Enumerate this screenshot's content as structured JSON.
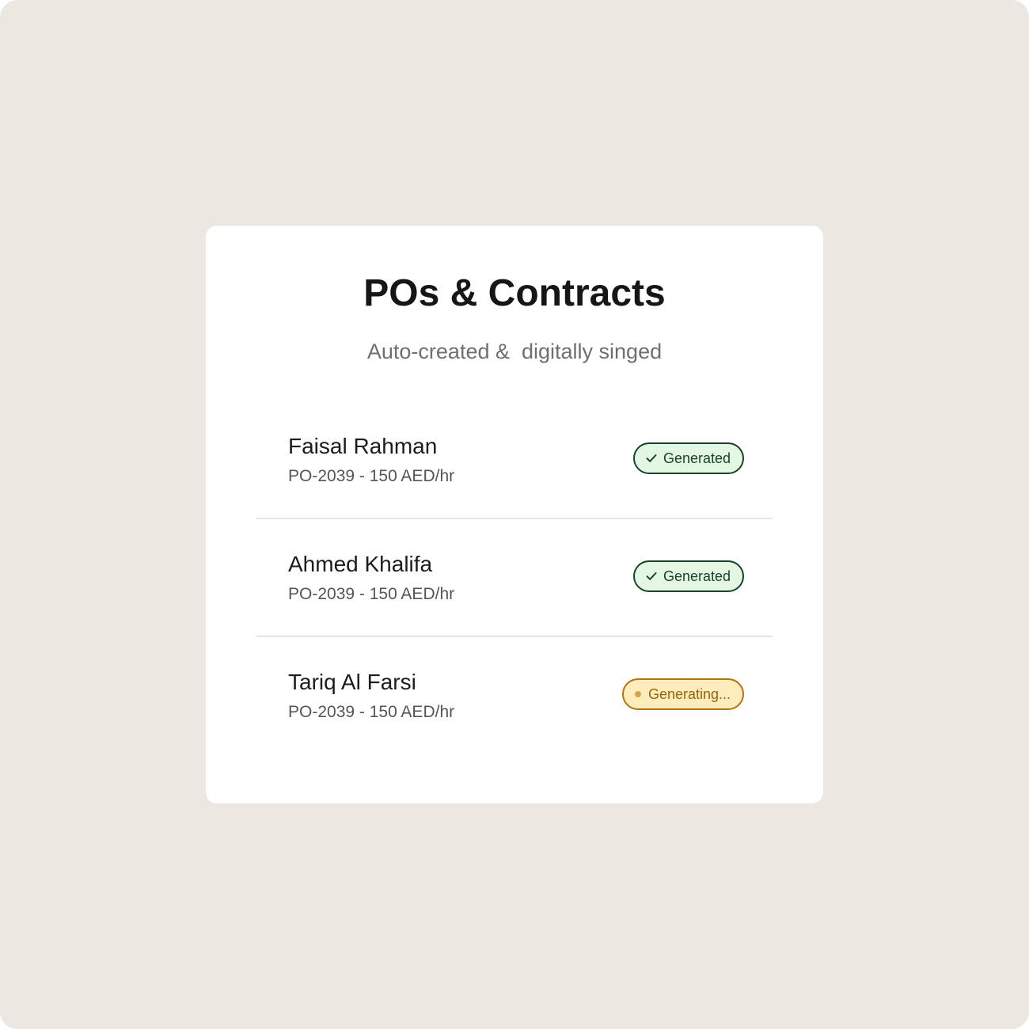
{
  "card": {
    "title": "POs & Contracts",
    "subtitle": "Auto-created &  digitally singed"
  },
  "items": [
    {
      "name": "Faisal Rahman",
      "detail": "PO-2039 - 150 AED/hr",
      "status": "Generated",
      "status_type": "done",
      "icon": "check-icon"
    },
    {
      "name": "Ahmed Khalifa",
      "detail": "PO-2039 - 150 AED/hr",
      "status": "Generated",
      "status_type": "done",
      "icon": "check-icon"
    },
    {
      "name": "Tariq Al Farsi",
      "detail": "PO-2039 - 150 AED/hr",
      "status": "Generating...",
      "status_type": "pending",
      "icon": "dot-icon"
    }
  ],
  "colors": {
    "background": "#ece7e1",
    "card": "#ffffff",
    "generated_bg": "#e3f7e3",
    "generated_border": "#17432b",
    "generating_bg": "#fdedbd",
    "generating_border": "#b3730f"
  }
}
